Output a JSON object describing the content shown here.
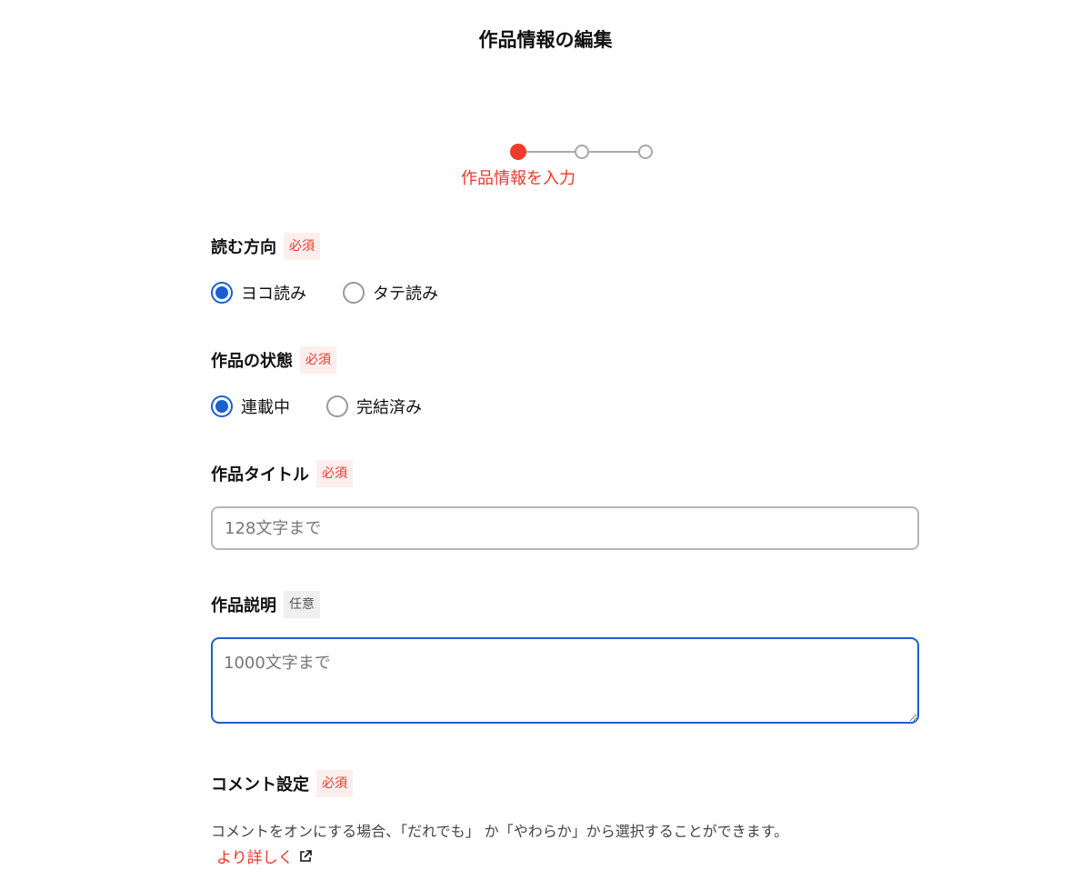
{
  "page": {
    "title": "作品情報の編集"
  },
  "stepper": {
    "current_step_label": "作品情報を入力",
    "total_steps": 3,
    "current_step": 1
  },
  "form": {
    "read_direction": {
      "label": "読む方向",
      "badge": "必須",
      "options": [
        {
          "label": "ヨコ読み",
          "selected": true
        },
        {
          "label": "タテ読み",
          "selected": false
        }
      ]
    },
    "status": {
      "label": "作品の状態",
      "badge": "必須",
      "options": [
        {
          "label": "連載中",
          "selected": true
        },
        {
          "label": "完結済み",
          "selected": false
        }
      ]
    },
    "title": {
      "label": "作品タイトル",
      "badge": "必須",
      "placeholder": "128文字まで",
      "value": ""
    },
    "description": {
      "label": "作品説明",
      "badge": "任意",
      "placeholder": "1000文字まで",
      "value": ""
    },
    "comment_settings": {
      "label": "コメント設定",
      "badge": "必須",
      "help_text": "コメントをオンにする場合、「だれでも」 か「やわらか」から選択することができます。",
      "link_label": "より詳しく",
      "link_icon": "external-link-icon"
    }
  },
  "colors": {
    "accent_red": "#e8392a",
    "accent_blue": "#1a5fd0",
    "required_badge_bg": "#fdeeee",
    "optional_badge_bg": "#efefef"
  }
}
